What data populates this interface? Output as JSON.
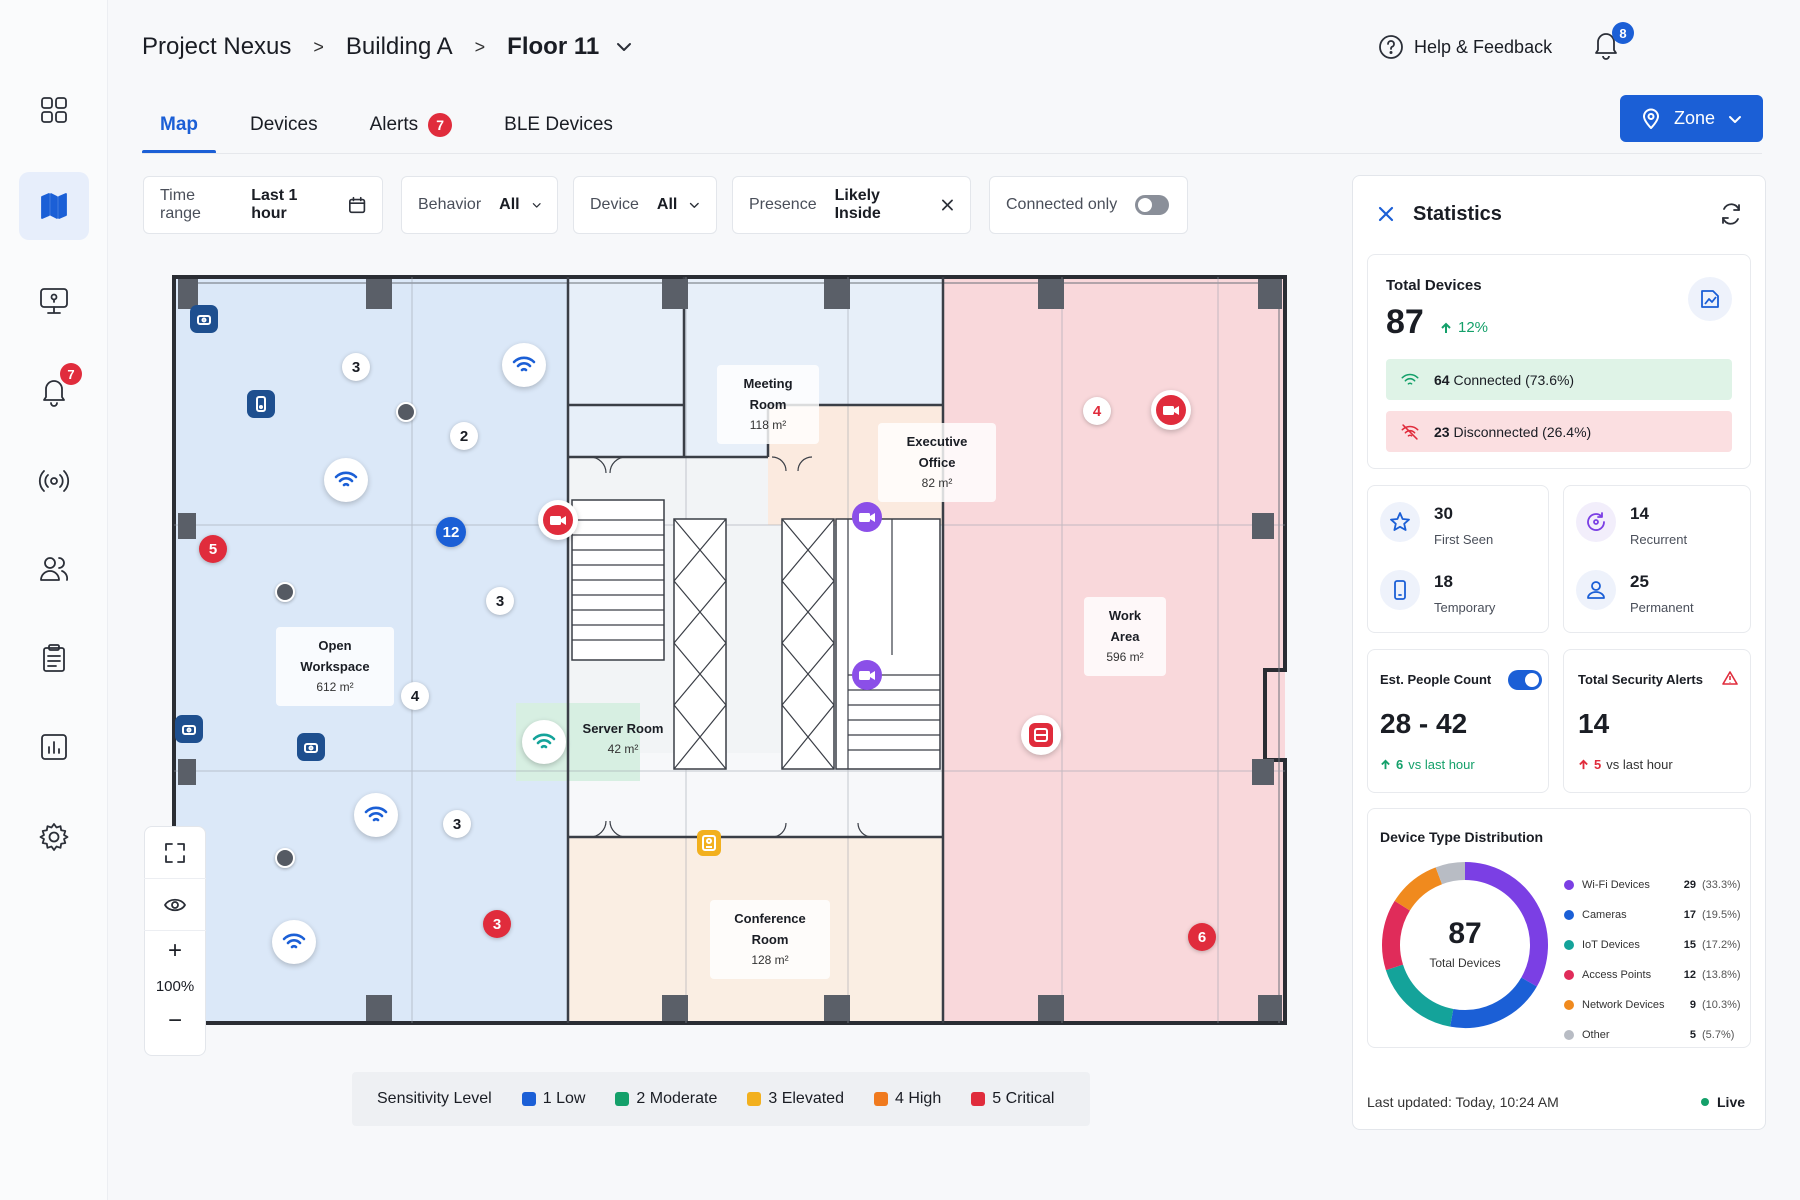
{
  "breadcrumb": {
    "project": "Project Nexus",
    "building": "Building A",
    "floor": "Floor 11",
    "separator": ">"
  },
  "header": {
    "help_label": "Help & Feedback",
    "notification_count": "8"
  },
  "sidebar": {
    "alerts_badge": "7"
  },
  "tabs": [
    {
      "label": "Map",
      "active": true
    },
    {
      "label": "Devices"
    },
    {
      "label": "Alerts",
      "badge": "7"
    },
    {
      "label": "BLE Devices"
    }
  ],
  "zone_button": {
    "label": "Zone"
  },
  "filters": {
    "time_range": {
      "label": "Time range",
      "value": "Last 1 hour"
    },
    "behavior": {
      "label": "Behavior",
      "value": "All"
    },
    "device": {
      "label": "Device",
      "value": "All"
    },
    "presence": {
      "label": "Presence",
      "value": "Likely Inside"
    },
    "connected_only": {
      "label": "Connected only",
      "enabled": false
    }
  },
  "rooms": {
    "meeting": {
      "name": "Meeting Room",
      "area": "118 m²"
    },
    "executive": {
      "name": "Executive Office",
      "area": "82 m²"
    },
    "open_workspace": {
      "name": "Open Workspace",
      "area": "612 m²"
    },
    "server": {
      "name": "Server Room",
      "area": "42 m²"
    },
    "work_area": {
      "name": "Work Area",
      "area": "596 m²"
    },
    "conference": {
      "name": "Conference Room",
      "area": "128 m²"
    }
  },
  "map_pins": {
    "c1": "3",
    "c2": "2",
    "c3": "3",
    "c4": "4",
    "c5": "3",
    "r1": "5",
    "r2": "4",
    "r3": "3",
    "r4": "6",
    "b1": "12"
  },
  "zoom": {
    "level": "100%",
    "plus": "+",
    "minus": "−"
  },
  "legend": {
    "title": "Sensitivity Level",
    "items": [
      {
        "label": "1 Low",
        "color": "#1b5fd6"
      },
      {
        "label": "2 Moderate",
        "color": "#14a06a"
      },
      {
        "label": "3 Elevated",
        "color": "#f2b01e"
      },
      {
        "label": "4 High",
        "color": "#f07a1e"
      },
      {
        "label": "5 Critical",
        "color": "#e02c3c"
      }
    ]
  },
  "statistics": {
    "title": "Statistics",
    "total_devices": {
      "label": "Total Devices",
      "value": "87",
      "change": "12%"
    },
    "connected": {
      "count": "64",
      "label": "Connected (73.6%)"
    },
    "disconnected": {
      "count": "23",
      "label": "Disconnected (26.4%)"
    },
    "first_seen": {
      "value": "30",
      "label": "First Seen"
    },
    "recurrent": {
      "value": "14",
      "label": "Recurrent"
    },
    "temporary": {
      "value": "18",
      "label": "Temporary"
    },
    "permanent": {
      "value": "25",
      "label": "Permanent"
    },
    "people": {
      "label": "Est. People Count",
      "value": "28 - 42",
      "change": "6",
      "change_label": "vs last hour",
      "enabled": true
    },
    "security_alerts": {
      "label": "Total Security Alerts",
      "value": "14",
      "change": "5",
      "change_label": "vs last hour"
    },
    "distribution": {
      "title": "Device Type Distribution",
      "total": "87",
      "total_label": "Total Devices",
      "items": [
        {
          "label": "Wi-Fi Devices",
          "count": 29,
          "pct": "(33.3%)",
          "color": "#7b3fe4"
        },
        {
          "label": "Cameras",
          "count": 17,
          "pct": "(19.5%)",
          "color": "#1b5fd6"
        },
        {
          "label": "IoT Devices",
          "count": 15,
          "pct": "(17.2%)",
          "color": "#14a39a"
        },
        {
          "label": "Access Points",
          "count": 12,
          "pct": "(13.8%)",
          "color": "#e02c5a"
        },
        {
          "label": "Network Devices",
          "count": 9,
          "pct": "(10.3%)",
          "color": "#f08a1e"
        },
        {
          "label": "Other",
          "count": 5,
          "pct": "(5.7%)",
          "color": "#b8bcc4"
        }
      ]
    },
    "last_updated": "Last updated: Today, 10:24 AM",
    "live_label": "Live"
  }
}
